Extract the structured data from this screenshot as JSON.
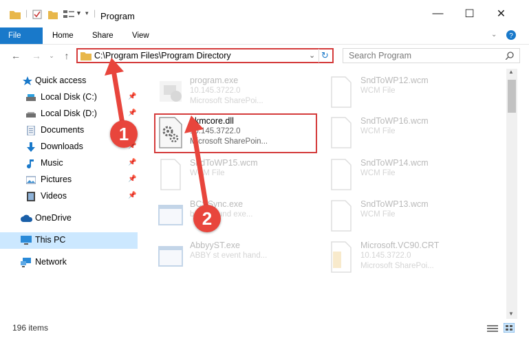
{
  "window": {
    "title": "Program",
    "controls": {
      "minimize": "—",
      "maximize": "☐",
      "close": "✕"
    }
  },
  "ribbon": {
    "tabs": [
      "File",
      "Home",
      "Share",
      "View"
    ]
  },
  "address": {
    "path": "C:\\Program Files\\Program Directory",
    "search_placeholder": "Search Program"
  },
  "sidebar": {
    "items": [
      {
        "label": "Quick access",
        "icon": "star-icon",
        "pinned": false
      },
      {
        "label": "Local Disk (C:)",
        "icon": "drive-icon",
        "pinned": true
      },
      {
        "label": "Local Disk (D:)",
        "icon": "drive-icon",
        "pinned": true
      },
      {
        "label": "Documents",
        "icon": "documents-icon",
        "pinned": true
      },
      {
        "label": "Downloads",
        "icon": "downloads-icon",
        "pinned": true
      },
      {
        "label": "Music",
        "icon": "music-icon",
        "pinned": true
      },
      {
        "label": "Pictures",
        "icon": "pictures-icon",
        "pinned": true
      },
      {
        "label": "Videos",
        "icon": "videos-icon",
        "pinned": true
      },
      {
        "label": "OneDrive",
        "icon": "onedrive-icon",
        "pinned": false
      },
      {
        "label": "This PC",
        "icon": "pc-icon",
        "pinned": false
      },
      {
        "label": "Network",
        "icon": "network-icon",
        "pinned": false
      }
    ]
  },
  "files": [
    {
      "name": "program.exe",
      "line2": "10.145.3722.0",
      "line3": "Microsoft SharePoi..."
    },
    {
      "name": "SndToWP12.wcm",
      "line2": "WCM File",
      "line3": ""
    },
    {
      "name": "pkmcore.dll",
      "line2": "10.145.3722.0",
      "line3": "Microsoft SharePoin..."
    },
    {
      "name": "SndToWP16.wcm",
      "line2": "WCM File",
      "line3": ""
    },
    {
      "name": "SndToWP15.wcm",
      "line2": "WCM File",
      "line3": ""
    },
    {
      "name": "SndToWP14.wcm",
      "line2": "WCM File",
      "line3": ""
    },
    {
      "name": "BCSSync.exe",
      "line2": "background exe...",
      "line3": ""
    },
    {
      "name": "SndToWP13.wcm",
      "line2": "WCM File",
      "line3": ""
    },
    {
      "name": "AbbyyST.exe",
      "line2": "ABBY st event hand...",
      "line3": ""
    },
    {
      "name": "Microsoft.VC90.CRT",
      "line2": "10.145.3722.0",
      "line3": "Microsoft SharePoi..."
    }
  ],
  "status": {
    "items": "196 items"
  },
  "annotations": {
    "step1": "1",
    "step2": "2"
  },
  "colors": {
    "accent": "#1979ca",
    "highlight": "#d43a3a",
    "selected": "#cce8ff"
  }
}
